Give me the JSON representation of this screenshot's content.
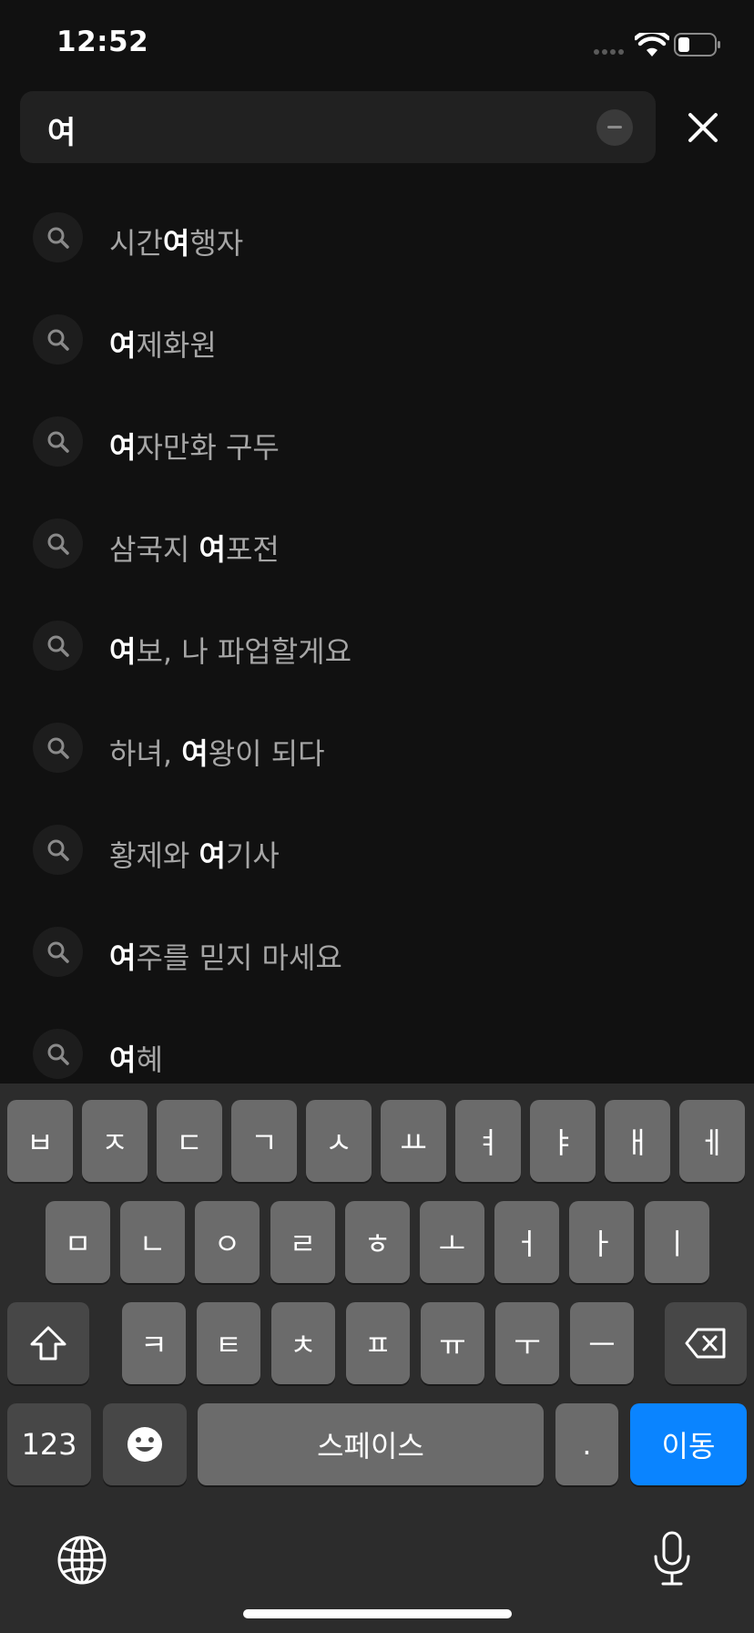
{
  "status_bar": {
    "time": "12:52",
    "icons": [
      "signal-dots-icon",
      "wifi-icon",
      "battery-icon"
    ]
  },
  "search": {
    "value": "여",
    "clear_icon": "clear-icon",
    "close_icon": "close-icon"
  },
  "suggestions": [
    {
      "before": "시간",
      "match": "여",
      "after": "행자"
    },
    {
      "before": "",
      "match": "여",
      "after": "제화원"
    },
    {
      "before": "",
      "match": "여",
      "after": "자만화 구두"
    },
    {
      "before": "삼국지 ",
      "match": "여",
      "after": "포전"
    },
    {
      "before": "",
      "match": "여",
      "after": "보, 나 파업할게요"
    },
    {
      "before": "하녀, ",
      "match": "여",
      "after": "왕이 되다"
    },
    {
      "before": "황제와 ",
      "match": "여",
      "after": "기사"
    },
    {
      "before": "",
      "match": "여",
      "after": "주를 믿지 마세요"
    },
    {
      "before": "",
      "match": "여",
      "after": "혜"
    }
  ],
  "keyboard": {
    "row1": [
      "ㅂ",
      "ㅈ",
      "ㄷ",
      "ㄱ",
      "ㅅ",
      "ㅛ",
      "ㅕ",
      "ㅑ",
      "ㅐ",
      "ㅔ"
    ],
    "row2": [
      "ㅁ",
      "ㄴ",
      "ㅇ",
      "ㄹ",
      "ㅎ",
      "ㅗ",
      "ㅓ",
      "ㅏ",
      "ㅣ"
    ],
    "row3": [
      "ㅋ",
      "ㅌ",
      "ㅊ",
      "ㅍ",
      "ㅠ",
      "ㅜ",
      "ㅡ"
    ],
    "numbers_label": "123",
    "space_label": "스페이스",
    "period_label": ".",
    "go_label": "이동",
    "accent_color": "#0a84ff",
    "icons": [
      "shift-icon",
      "backspace-icon",
      "emoji-icon",
      "globe-icon",
      "microphone-icon"
    ]
  }
}
